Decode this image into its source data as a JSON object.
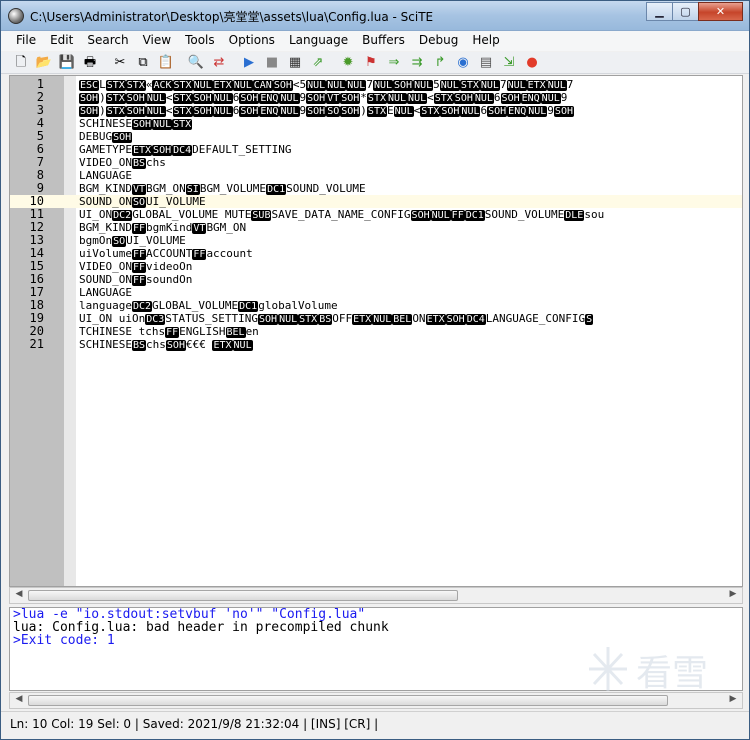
{
  "window": {
    "title": "C:\\Users\\Administrator\\Desktop\\亮堂堂\\assets\\lua\\Config.lua - SciTE"
  },
  "window_buttons": {
    "minimize": "▁",
    "maximize": "▢",
    "close": "✕"
  },
  "menu": [
    "File",
    "Edit",
    "Search",
    "View",
    "Tools",
    "Options",
    "Language",
    "Buffers",
    "Debug",
    "Help"
  ],
  "toolbar": [
    {
      "name": "new-file-icon",
      "glyph": "🗋"
    },
    {
      "name": "open-file-icon",
      "glyph": "📂"
    },
    {
      "name": "save-icon",
      "glyph": "💾"
    },
    {
      "name": "print-icon",
      "glyph": "🖶"
    },
    {
      "name": "cut-icon",
      "glyph": "✂"
    },
    {
      "name": "copy-icon",
      "glyph": "⧉"
    },
    {
      "name": "paste-icon",
      "glyph": "📋"
    },
    {
      "name": "find-icon",
      "glyph": "🔍"
    },
    {
      "name": "replace-icon",
      "glyph": "⇄"
    },
    {
      "name": "compile-icon",
      "glyph": "▶"
    },
    {
      "name": "stop-icon",
      "glyph": "■"
    },
    {
      "name": "build-icon",
      "glyph": "▦"
    },
    {
      "name": "go-icon",
      "glyph": "⇗"
    },
    {
      "name": "debug-icon",
      "glyph": "✹"
    },
    {
      "name": "debug-stop-icon",
      "glyph": "⚑"
    },
    {
      "name": "step-icon",
      "glyph": "⇒"
    },
    {
      "name": "step-over-icon",
      "glyph": "⇉"
    },
    {
      "name": "step-out-icon",
      "glyph": "↱"
    },
    {
      "name": "watch-icon",
      "glyph": "◉"
    },
    {
      "name": "locals-icon",
      "glyph": "▤"
    },
    {
      "name": "run-to-icon",
      "glyph": "⇲"
    },
    {
      "name": "breakpoint-icon",
      "glyph": "●"
    }
  ],
  "editor": {
    "caret_line": 10,
    "lines": [
      [
        {
          "c": "ESC"
        },
        {
          "t": "L"
        },
        {
          "c": "STX"
        },
        {
          "c": "STX"
        },
        {
          "t": "«"
        },
        {
          "c": "ACK"
        },
        {
          "c": "STX"
        },
        {
          "c": "NUL"
        },
        {
          "c": "ETX"
        },
        {
          "c": "NUL"
        },
        {
          "c": "CAN"
        },
        {
          "c": "SOH"
        },
        {
          "t": "<5"
        },
        {
          "c": "NUL"
        },
        {
          "c": "NUL"
        },
        {
          "c": "NUL"
        },
        {
          "t": "7"
        },
        {
          "c": "NUL"
        },
        {
          "c": "SOH"
        },
        {
          "c": "NUL"
        },
        {
          "t": "5"
        },
        {
          "c": "NUL"
        },
        {
          "c": "STX"
        },
        {
          "c": "NUL"
        },
        {
          "t": "7"
        },
        {
          "c": "NUL"
        },
        {
          "c": "ETX"
        },
        {
          "c": "NUL"
        },
        {
          "t": "7"
        }
      ],
      [
        {
          "c": "SOH"
        },
        {
          "t": ")"
        },
        {
          "c": "STX"
        },
        {
          "c": "SOH"
        },
        {
          "c": "NUL"
        },
        {
          "t": "<"
        },
        {
          "c": "STX"
        },
        {
          "c": "SOH"
        },
        {
          "c": "NUL"
        },
        {
          "t": "6"
        },
        {
          "c": "SOH"
        },
        {
          "c": "ENQ"
        },
        {
          "c": "NUL"
        },
        {
          "t": "9"
        },
        {
          "c": "SOH"
        },
        {
          "c": "VT"
        },
        {
          "c": "SOH"
        },
        {
          "t": "*"
        },
        {
          "c": "STX"
        },
        {
          "c": "NUL"
        },
        {
          "c": "NUL"
        },
        {
          "t": "<"
        },
        {
          "c": "STX"
        },
        {
          "c": "SOH"
        },
        {
          "c": "NUL"
        },
        {
          "t": "6"
        },
        {
          "c": "SOH"
        },
        {
          "c": "ENQ"
        },
        {
          "c": "NUL"
        },
        {
          "t": "9"
        }
      ],
      [
        {
          "c": "SOH"
        },
        {
          "t": ")"
        },
        {
          "c": "STX"
        },
        {
          "c": "SOH"
        },
        {
          "c": "NUL"
        },
        {
          "t": "<"
        },
        {
          "c": "STX"
        },
        {
          "c": "SOH"
        },
        {
          "c": "NUL"
        },
        {
          "t": "6"
        },
        {
          "c": "SOH"
        },
        {
          "c": "ENQ"
        },
        {
          "c": "NUL"
        },
        {
          "t": "9"
        },
        {
          "c": "SOH"
        },
        {
          "c": "SO"
        },
        {
          "c": "SOH"
        },
        {
          "t": ")"
        },
        {
          "c": "STX"
        },
        {
          "t": "E"
        },
        {
          "c": "NUL"
        },
        {
          "t": "<"
        },
        {
          "c": "STX"
        },
        {
          "c": "SOH"
        },
        {
          "c": "NUL"
        },
        {
          "t": "6"
        },
        {
          "c": "SOH"
        },
        {
          "c": "ENQ"
        },
        {
          "c": "NUL"
        },
        {
          "t": "9"
        },
        {
          "c": "SOH"
        }
      ],
      [
        {
          "t": "SCHINESE"
        },
        {
          "c": "SOH"
        },
        {
          "c": "NUL"
        },
        {
          "c": "STX"
        }
      ],
      [
        {
          "t": "DEBUG"
        },
        {
          "c": "SOH"
        }
      ],
      [
        {
          "t": "GAMETYPE"
        },
        {
          "c": "ETX"
        },
        {
          "c": "SOH"
        },
        {
          "c": "DC4"
        },
        {
          "t": "DEFAULT_SETTING"
        }
      ],
      [
        {
          "t": "VIDEO_ON"
        },
        {
          "c": "BS"
        },
        {
          "t": "chs"
        }
      ],
      [
        {
          "t": "LANGUAGE"
        }
      ],
      [
        {
          "t": "BGM_KIND"
        },
        {
          "c": "VT"
        },
        {
          "t": "BGM_ON"
        },
        {
          "c": "SI"
        },
        {
          "t": "BGM_VOLUME"
        },
        {
          "c": "DC1"
        },
        {
          "t": "SOUND_VOLUME"
        }
      ],
      [
        {
          "t": "SOUND_ON"
        },
        {
          "c": "SO"
        },
        {
          "t": "UI_VOLUME"
        }
      ],
      [
        {
          "t": "UI_ON"
        },
        {
          "c": "DC2"
        },
        {
          "t": "GLOBAL_VOLUME   MUTE"
        },
        {
          "c": "SUB"
        },
        {
          "t": "SAVE_DATA_NAME_CONFIG"
        },
        {
          "c": "SOH"
        },
        {
          "c": "NUL"
        },
        {
          "c": "FF"
        },
        {
          "c": "DC1"
        },
        {
          "t": "SOUND_VOLUME"
        },
        {
          "c": "DLE"
        },
        {
          "t": "sou"
        }
      ],
      [
        {
          "t": "BGM_KIND"
        },
        {
          "c": "FF"
        },
        {
          "t": "bgmKind"
        },
        {
          "c": "VT"
        },
        {
          "t": "BGM_ON"
        }
      ],
      [
        {
          "t": "bgmOn"
        },
        {
          "c": "SO"
        },
        {
          "t": "UI_VOLUME"
        }
      ],
      [
        {
          "t": "uiVolume"
        },
        {
          "c": "FF"
        },
        {
          "t": "ACCOUNT"
        },
        {
          "c": "FF"
        },
        {
          "t": "account"
        }
      ],
      [
        {
          "t": "VIDEO_ON"
        },
        {
          "c": "FF"
        },
        {
          "t": "videoOn"
        }
      ],
      [
        {
          "t": "SOUND_ON"
        },
        {
          "c": "FF"
        },
        {
          "t": "soundOn"
        }
      ],
      [
        {
          "t": "LANGUAGE"
        }
      ],
      [
        {
          "t": "language"
        },
        {
          "c": "DC2"
        },
        {
          "t": "GLOBAL_VOLUME"
        },
        {
          "c": "DC1"
        },
        {
          "t": "globalVolume"
        }
      ],
      [
        {
          "t": "UI_ON   uiOn"
        },
        {
          "c": "DC3"
        },
        {
          "t": "STATUS_SETTING"
        },
        {
          "c": "SOH"
        },
        {
          "c": "NUL"
        },
        {
          "c": "STX"
        },
        {
          "c": "BS"
        },
        {
          "t": "OFF"
        },
        {
          "c": "ETX"
        },
        {
          "c": "NUL"
        },
        {
          "c": "BEL"
        },
        {
          "t": "ON"
        },
        {
          "c": "ETX"
        },
        {
          "c": "SOH"
        },
        {
          "c": "DC4"
        },
        {
          "t": "LANGUAGE_CONFIG"
        },
        {
          "c": "S"
        }
      ],
      [
        {
          "t": "TCHINESE    tchs"
        },
        {
          "c": "FF"
        },
        {
          "t": "ENGLISH"
        },
        {
          "c": "BEL"
        },
        {
          "t": "en"
        }
      ],
      [
        {
          "t": "SCHINESE"
        },
        {
          "c": "BS"
        },
        {
          "t": "chs"
        },
        {
          "c": "SOH"
        },
        {
          "t": "€€€  "
        },
        {
          "c": "ETX"
        },
        {
          "c": "NUL"
        }
      ]
    ]
  },
  "output": {
    "command": ">lua -e \"io.stdout:setvbuf 'no'\" \"Config.lua\"",
    "error": "lua: Config.lua: bad header in precompiled chunk",
    "exit": ">Exit code: 1"
  },
  "status": {
    "text": "Ln: 10 Col: 19 Sel: 0   |   Saved: 2021/9/8  21:32:04   |   [INS]  [CR] |"
  },
  "watermark": {
    "text": "看雪"
  }
}
